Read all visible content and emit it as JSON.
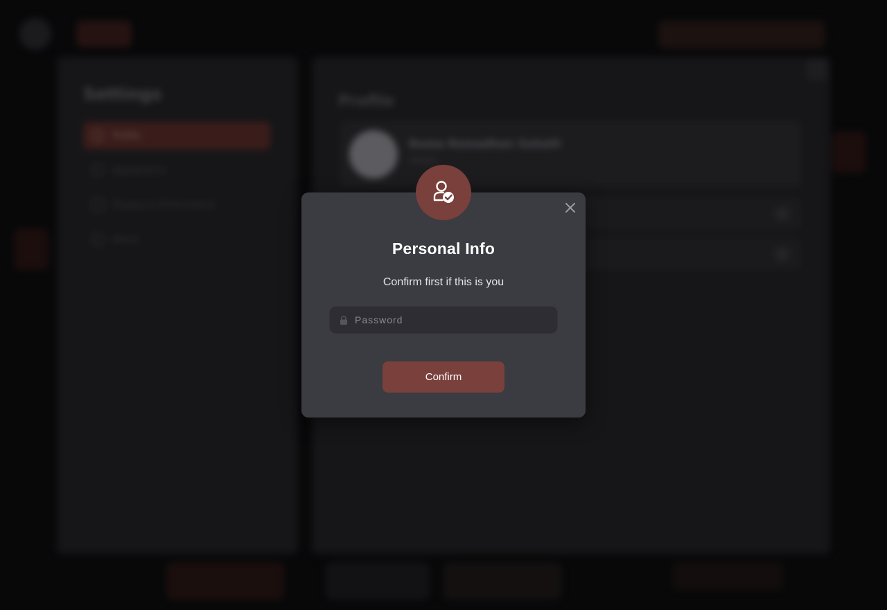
{
  "background": {
    "sidebar": {
      "title": "Settings",
      "items": [
        {
          "label": "Profile",
          "active": true
        },
        {
          "label": "Appearance",
          "active": false
        },
        {
          "label": "Display & Performance",
          "active": false
        },
        {
          "label": "About",
          "active": false
        }
      ]
    },
    "main": {
      "title": "Profile",
      "user_name": "Roma Ramadhan Suhaili"
    }
  },
  "modal": {
    "icon": "user-check-icon",
    "title": "Personal Info",
    "subtitle": "Confirm first if this is you",
    "password": {
      "placeholder": "Password",
      "value": ""
    },
    "confirm_label": "Confirm"
  },
  "colors": {
    "accent": "#7a413c",
    "modal_bg": "#3b3b42",
    "input_bg": "#2d2d33",
    "page_bg": "#0d0d0f"
  }
}
